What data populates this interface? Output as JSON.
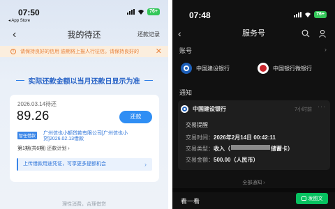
{
  "left": {
    "status": {
      "time": "07:50",
      "back_app": "◂ App Store",
      "battery": "76+"
    },
    "nav": {
      "title": "我的待还",
      "back": "‹",
      "records": "还款记录"
    },
    "notice": {
      "icon": "!",
      "text": "请保持良好的信用    逾期将上报人行征信。请保持良好的",
      "close": "✕"
    },
    "banner": "实际还款金额以当月还款日显示为准",
    "card": {
      "due_date": "2026.03.14待还",
      "amount": "89.26",
      "pay_button": "还款",
      "tag": "智任借款",
      "lender": "广州信也小额贷款有限公司[广州信也小贷]2026.02.13借款",
      "period": "第1期(共6期)",
      "plan_link": "还款计划 ›",
      "upload_text": "上传借款用途凭证，可享更多提额机会",
      "upload_arrow": "›"
    },
    "footer": "理性消费，合理借贷"
  },
  "right": {
    "status": {
      "time": "07:48",
      "battery": "76+"
    },
    "nav": {
      "title": "服务号",
      "back": "‹"
    },
    "accounts_label": "账号",
    "accounts_arrow": "›",
    "accounts": [
      "中国建设银行",
      "中国银行微银行"
    ],
    "notice_label": "通知",
    "notification": {
      "bank": "中国建设银行",
      "time": "7小时前",
      "more": "···",
      "type": "交易提醒",
      "rows": [
        {
          "key": "交易时间：",
          "value": "2026年2月14日 00:42:11"
        },
        {
          "key": "交易类型：",
          "value_pre": "收入（",
          "value_post": "储蓄卡）"
        },
        {
          "key": "交易金额：",
          "value": "500.00（人民币）"
        }
      ]
    },
    "all_notices": "全部通知 ›",
    "look": "看一看",
    "post_button": "发图文"
  }
}
